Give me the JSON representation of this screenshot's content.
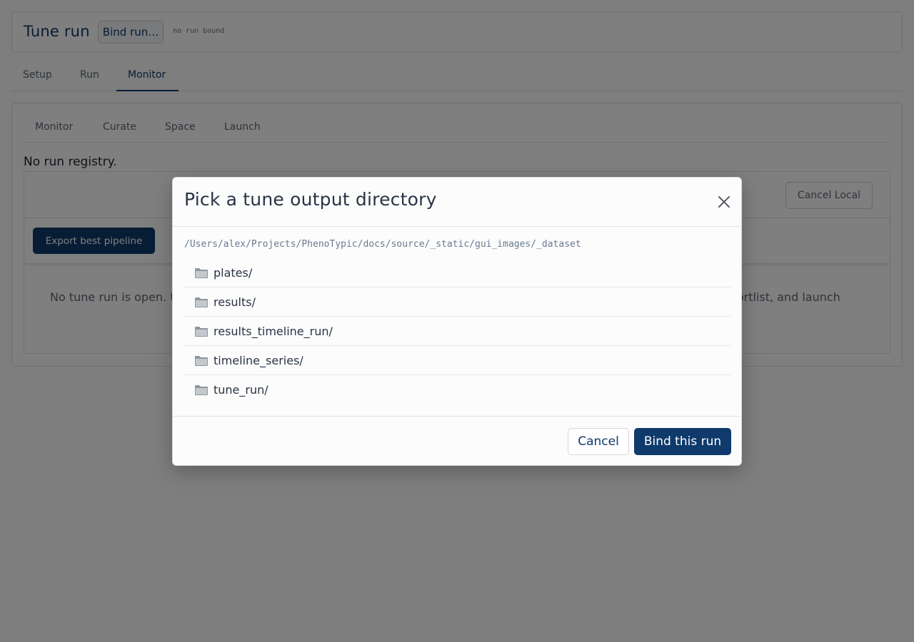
{
  "app": {
    "title": "Tune run",
    "bind_run_label": "Bind run…",
    "run_status": "no run bound"
  },
  "top_tabs": [
    {
      "label": "Setup"
    },
    {
      "label": "Run"
    },
    {
      "label": "Monitor",
      "active": true
    }
  ],
  "sub_tabs": [
    {
      "label": "Monitor"
    },
    {
      "label": "Curate"
    },
    {
      "label": "Space"
    },
    {
      "label": "Launch"
    }
  ],
  "monitor": {
    "registry_status": "No run registry.",
    "cancel_local_label": "Cancel Local",
    "export_label": "Export best pipeline",
    "empty_message_start": "No tune run is open. U",
    "empty_message_end": "s shortlist, and launch"
  },
  "modal": {
    "title": "Pick a tune output directory",
    "path": "/Users/alex/Projects/PhenoTypic/docs/source/_static/gui_images/_dataset",
    "folders": [
      {
        "name": "plates/",
        "icon": "folder-icon"
      },
      {
        "name": "results/",
        "icon": "folder-icon"
      },
      {
        "name": "results_timeline_run/",
        "icon": "folder-icon"
      },
      {
        "name": "timeline_series/",
        "icon": "folder-icon"
      },
      {
        "name": "tune_run/",
        "icon": "folder-icon"
      }
    ],
    "cancel_label": "Cancel",
    "confirm_label": "Bind this run"
  },
  "colors": {
    "accent": "#0f3a6b",
    "backdrop": "rgba(0,0,0,0.5)",
    "modal_bg": "#fbfcfb"
  }
}
